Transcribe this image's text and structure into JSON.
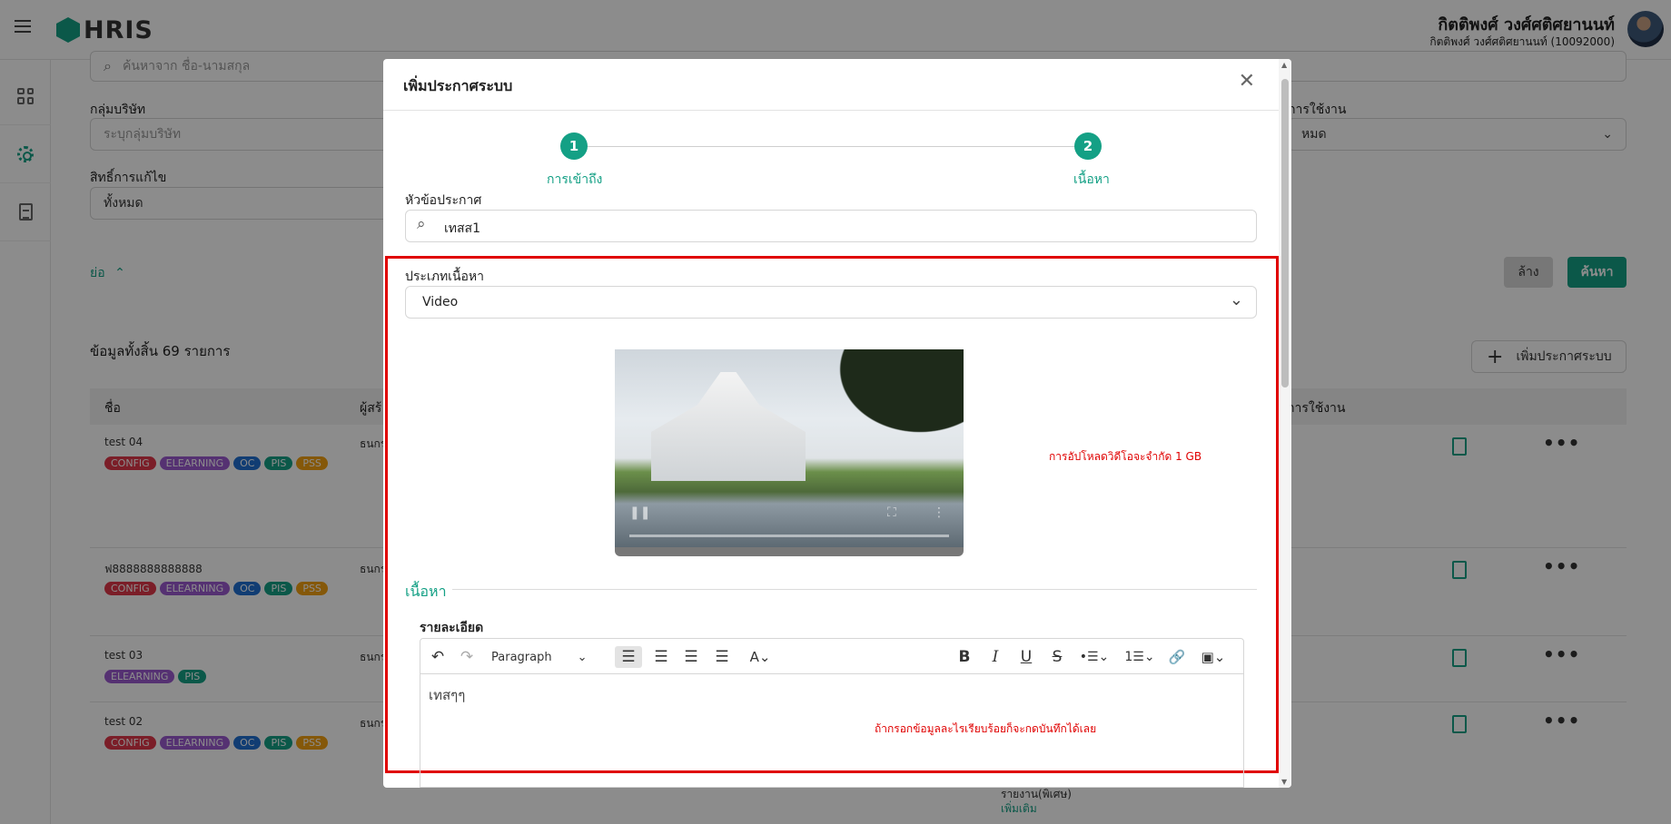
{
  "app": {
    "logo": "HRIS",
    "user_name": "กิตติพงศ์ วงศ์ศติศยานนท์",
    "user_sub": "กิตติพงศ์ วงศ์ศติศยานนท์ (10092000)"
  },
  "filters": {
    "search_placeholder": "ค้นหาจาก ชื่อ-นามสกุล",
    "company_label": "กลุ่มบริษัท",
    "company_placeholder": "ระบุกลุ่มบริษัท",
    "edit_right_label": "สิทธิ์การแก้ไข",
    "edit_right_value": "ทั้งหมด",
    "usage_label": "การใช้งาน",
    "usage_value": "หมด",
    "collapse_label": "ย่อ",
    "clear_button": "ล้าง",
    "search_button": "ค้นหา"
  },
  "list": {
    "total_label": "ข้อมูลทั้งสิ้น 69 รายการ",
    "add_button": "เพิ่มประกาศระบบ",
    "col_name": "ชื่อ",
    "col_creator": "ผู้สร้",
    "col_usage": "การใช้งาน",
    "rows": [
      {
        "name": "test 04",
        "creator": "ธนกร",
        "tags": [
          "CONFIG",
          "ELEARNING",
          "OC",
          "PIS",
          "PSS"
        ]
      },
      {
        "name": "ฟ8888888888888",
        "creator": "ธนกร",
        "tags": [
          "CONFIG",
          "ELEARNING",
          "OC",
          "PIS",
          "PSS"
        ]
      },
      {
        "name": "test 03",
        "creator": "ธนกร",
        "tags": [
          "ELEARNING",
          "PIS"
        ]
      },
      {
        "name": "test 02",
        "creator": "ธนกร",
        "tags": [
          "CONFIG",
          "ELEARNING",
          "OC",
          "PIS",
          "PSS"
        ]
      }
    ],
    "extra_line1": "รายงาน(พิเศษ)",
    "extra_line2": "เพิ่มเติม"
  },
  "modal": {
    "title": "เพิ่มประกาศระบบ",
    "steps": [
      {
        "num": "1",
        "label": "การเข้าถึง"
      },
      {
        "num": "2",
        "label": "เนื้อหา"
      }
    ],
    "topic_label": "หัวข้อประกาศ",
    "topic_value": "เทสส1",
    "content_type_label": "ประเภทเนื้อหา",
    "content_type_value": "Video",
    "video_note": "การอัปโหลดวิดีโอจะจำกัด 1 GB",
    "section_title": "เนื้อหา",
    "detail_label": "รายละเอียด",
    "paragraph_select": "Paragraph",
    "editor_text": "เทสๆๆ",
    "editor_note": "ถ้ากรอกข้อมูลละไรเรียบร้อยก็จะกดบันทึกได้เลย"
  }
}
